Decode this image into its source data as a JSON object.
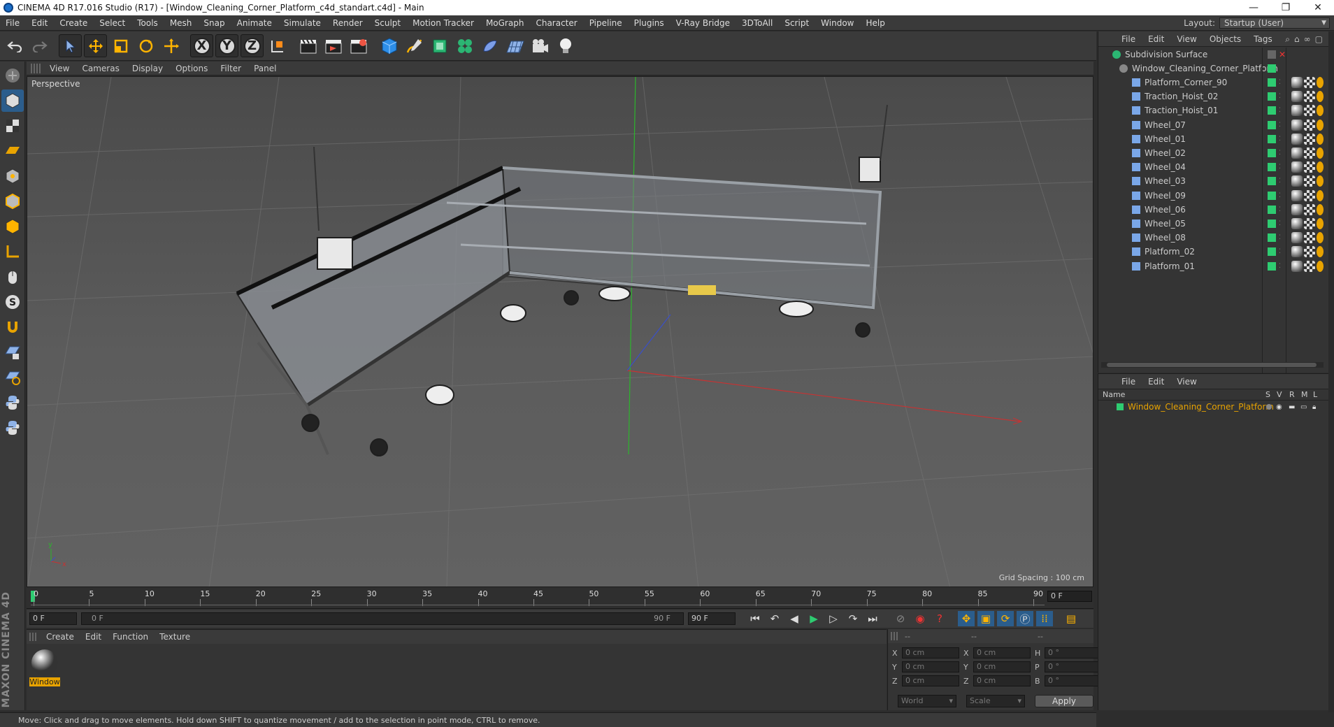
{
  "window": {
    "title": "CINEMA 4D R17.016 Studio (R17) - [Window_Cleaning_Corner_Platform_c4d_standart.c4d] - Main",
    "minimize": "—",
    "restore": "❐",
    "close": "✕"
  },
  "menu": [
    "File",
    "Edit",
    "Create",
    "Select",
    "Tools",
    "Mesh",
    "Snap",
    "Animate",
    "Simulate",
    "Render",
    "Sculpt",
    "Motion Tracker",
    "MoGraph",
    "Character",
    "Pipeline",
    "Plugins",
    "V-Ray Bridge",
    "3DToAll",
    "Script",
    "Window",
    "Help"
  ],
  "layout": {
    "label": "Layout:",
    "value": "Startup (User)"
  },
  "toolbar": {
    "axes": [
      "X",
      "Y",
      "Z"
    ]
  },
  "viewport": {
    "menu": [
      "View",
      "Cameras",
      "Display",
      "Options",
      "Filter",
      "Panel"
    ],
    "name": "Perspective",
    "grid_spacing": "Grid Spacing : 100 cm"
  },
  "timeline": {
    "ticks": [
      "0",
      "5",
      "10",
      "15",
      "20",
      "25",
      "30",
      "35",
      "40",
      "45",
      "50",
      "55",
      "60",
      "65",
      "70",
      "75",
      "80",
      "85",
      "90"
    ],
    "current_frame": "0 F"
  },
  "transport": {
    "start": "0 F",
    "range_start": "0 F",
    "range_end": "90 F",
    "end": "90 F"
  },
  "materials": {
    "menu": [
      "Create",
      "Edit",
      "Function",
      "Texture"
    ],
    "items": [
      {
        "label": "Window"
      }
    ]
  },
  "coords": {
    "headers": [
      "--",
      "--",
      "--"
    ],
    "rows": [
      {
        "a": "X",
        "av": "0 cm",
        "b": "X",
        "bv": "0 cm",
        "c": "H",
        "cv": "0 °"
      },
      {
        "a": "Y",
        "av": "0 cm",
        "b": "Y",
        "bv": "0 cm",
        "c": "P",
        "cv": "0 °"
      },
      {
        "a": "Z",
        "av": "0 cm",
        "b": "Z",
        "bv": "0 cm",
        "c": "B",
        "cv": "0 °"
      }
    ],
    "mode1": "World",
    "mode2": "Scale",
    "apply": "Apply"
  },
  "objects": {
    "menu": [
      "File",
      "Edit",
      "View",
      "Objects",
      "Tags"
    ],
    "root": "Subdivision Surface",
    "group": "Window_Cleaning_Corner_Platform",
    "children": [
      "Platform_Corner_90",
      "Traction_Hoist_02",
      "Traction_Hoist_01",
      "Wheel_07",
      "Wheel_01",
      "Wheel_02",
      "Wheel_04",
      "Wheel_03",
      "Wheel_09",
      "Wheel_06",
      "Wheel_05",
      "Wheel_08",
      "Platform_02",
      "Platform_01"
    ]
  },
  "attributes": {
    "menu": [
      "File",
      "Edit",
      "View"
    ],
    "headers": {
      "name": "Name",
      "s": "S",
      "v": "V",
      "r": "R",
      "m": "M",
      "l": "L"
    },
    "row": "Window_Cleaning_Corner_Platform"
  },
  "status": "Move: Click and drag to move elements. Hold down SHIFT to quantize movement / add to the selection in point mode, CTRL to remove.",
  "brand": "MAXON CINEMA 4D",
  "colors": {
    "accent_orange": "#e8a300",
    "green_layer": "#2ecc71"
  }
}
